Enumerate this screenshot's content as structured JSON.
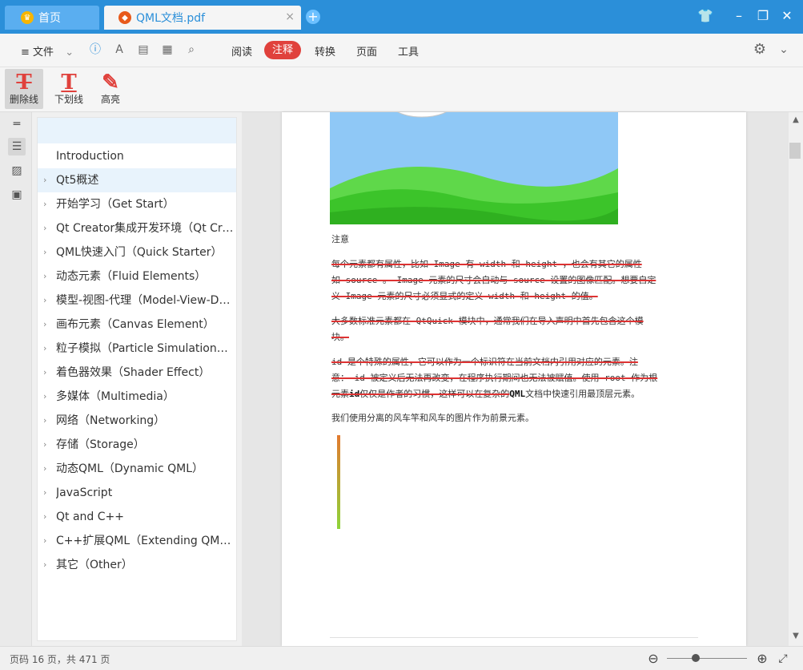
{
  "tabs": {
    "home": "首页",
    "document": "QML文档.pdf",
    "close": "×",
    "new": "+"
  },
  "window": {
    "skin": "👕",
    "minimize": "–",
    "restore": "❐",
    "close": "✕"
  },
  "menu": {
    "file": "文件",
    "items": [
      "阅读",
      "注释",
      "转换",
      "页面",
      "工具"
    ],
    "active": "注释"
  },
  "annotation_tools": [
    {
      "label": "删除线",
      "glyph": "T"
    },
    {
      "label": "下划线",
      "glyph": "T"
    },
    {
      "label": "高亮",
      "glyph": "✎"
    }
  ],
  "outline": [
    {
      "label": "Introduction",
      "expandable": false
    },
    {
      "label": "Qt5概述",
      "expandable": true
    },
    {
      "label": "开始学习（Get Start）",
      "expandable": true
    },
    {
      "label": "Qt Creator集成开发环境（Qt Creat…",
      "expandable": true
    },
    {
      "label": "QML快速入门（Quick Starter）",
      "expandable": true
    },
    {
      "label": "动态元素（Fluid Elements）",
      "expandable": true
    },
    {
      "label": "模型-视图-代理（Model-View-Dele…",
      "expandable": true
    },
    {
      "label": "画布元素（Canvas Element）",
      "expandable": true
    },
    {
      "label": "粒子模拟（Particle Simulations）",
      "expandable": true
    },
    {
      "label": "着色器效果（Shader Effect）",
      "expandable": true
    },
    {
      "label": "多媒体（Multimedia）",
      "expandable": true
    },
    {
      "label": "网络（Networking）",
      "expandable": true
    },
    {
      "label": "存储（Storage）",
      "expandable": true
    },
    {
      "label": "动态QML（Dynamic QML）",
      "expandable": true
    },
    {
      "label": "JavaScript",
      "expandable": true
    },
    {
      "label": "Qt and C++",
      "expandable": true
    },
    {
      "label": "C++扩展QML（Extending QML w…",
      "expandable": true
    },
    {
      "label": "其它（Other）",
      "expandable": true
    }
  ],
  "document": {
    "note_heading": "注意",
    "p1_l1": "每个元素都有属性，比如 Image 有 width 和 height ，也会有其它的属性",
    "p1_l2": "如 source 。 Image 元素的尺寸会自动与 source 设置的图像匹配。想要自定",
    "p1_l3": "义 Image 元素的尺寸必须显式的定义 width 和 height 的值。",
    "p2_l1": "大多数标准元素都在 QtQuick 模块中，通常我们在导入声明中首先包含这个模",
    "p2_l2": "块。",
    "p3_l1": " id 是个特殊的属性，它可以作为一个标识符在当前文档内引用对应的元素。注",
    "p3_l2": "意： id 被定义后无法再改变，在程序执行期间也无法被赋值。使用 root 作为根",
    "p3_l3a": "元素",
    "p3_l3b": "id",
    "p3_l3c": "仅仅是作者的习惯，这样可以在复杂的",
    "p3_l3d": "QML",
    "p3_l3e": "文档中快速引用最顶层元素。",
    "p4": "我们使用分离的风车竿和风车的图片作为前景元素。"
  },
  "status": {
    "page_info": "页码 16 页，共 471 页",
    "zoom_out": "⊖",
    "zoom_in": "⊕",
    "zoom_fraction": 0.36
  },
  "colors": {
    "titlebar": "#2b8fd9",
    "accent_red": "#e0413c",
    "outline_selected": "#e8f3fc"
  }
}
